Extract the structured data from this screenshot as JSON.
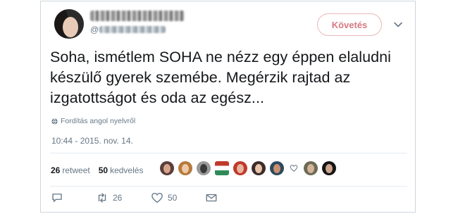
{
  "tweet": {
    "follow_label": "Követés",
    "handle_prefix": "@",
    "text": "Soha, ismétlem SOHA ne nézz egy éppen elaludni készülő gyerek szemébe. Megérzik rajtad az izgatottságot és oda az egész...",
    "translate_label": "Fordítás angol nyelvről",
    "timestamp": "10:44 - 2015. nov. 14.",
    "retweets_count": "26",
    "retweets_label": "retweet",
    "likes_count": "50",
    "likes_label": "kedvelés",
    "actions": {
      "retweet_count": "26",
      "like_count": "50"
    }
  },
  "colors": {
    "follow_accent": "#d57a80",
    "muted_text": "#657786",
    "divider": "#e6ecf0"
  },
  "icons": [
    "globe-icon",
    "chevron-down-icon",
    "reply-icon",
    "retweet-icon",
    "heart-icon",
    "envelope-icon"
  ]
}
